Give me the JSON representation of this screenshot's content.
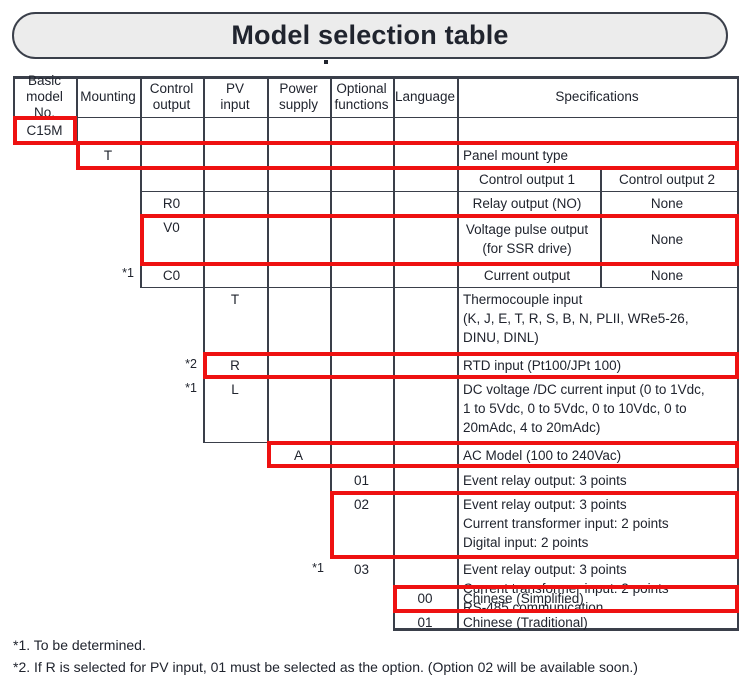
{
  "title": "Model selection table",
  "table": {
    "headers": [
      "Basic\nmodel No.",
      "Mounting",
      "Control\noutput",
      "PV\ninput",
      "Power\nsupply",
      "Optional\nfunctions",
      "Language",
      "Specifications"
    ],
    "subheaders": {
      "control_output_1": "Control output 1",
      "control_output_2": "Control output 2"
    },
    "rows": {
      "basic_model": {
        "code": "C15M"
      },
      "mounting": {
        "code": "T",
        "spec": "Panel mount type"
      },
      "control_output": [
        {
          "note": "",
          "code": "R0",
          "out1": "Relay output (NO)",
          "out2": "None"
        },
        {
          "note": "",
          "code": "V0",
          "out1": "Voltage pulse output\n(for SSR drive)",
          "out2": "None"
        },
        {
          "note": "*1",
          "code": "C0",
          "out1": "Current output",
          "out2": "None"
        }
      ],
      "pv_input": [
        {
          "note": "",
          "code": "T",
          "spec": "Thermocouple input\n(K, J, E, T, R, S, B, N, PLII, WRe5-26,\nDINU, DINL)"
        },
        {
          "note": "*2",
          "code": "R",
          "spec": "RTD input (Pt100/JPt 100)"
        },
        {
          "note": "*1",
          "code": "L",
          "spec": "DC voltage /DC current input (0 to 1Vdc,\n1 to 5Vdc, 0 to 5Vdc, 0 to 10Vdc, 0 to\n20mAdc, 4 to 20mAdc)"
        }
      ],
      "power_supply": [
        {
          "note": "",
          "code": "A",
          "spec": "AC Model (100 to 240Vac)"
        }
      ],
      "optional_functions": [
        {
          "note": "",
          "code": "01",
          "spec": "Event relay output: 3 points"
        },
        {
          "note": "",
          "code": "02",
          "spec": "Event relay output: 3 points\nCurrent transformer input: 2 points\nDigital input: 2 points"
        },
        {
          "note": "*1",
          "code": "03",
          "spec": "Event relay output: 3 points\nCurrent transformer input: 2 points\nRS-485 communication"
        }
      ],
      "language": [
        {
          "note": "",
          "code": "00",
          "spec": "Chinese (Simplified)"
        },
        {
          "note": "",
          "code": "01",
          "spec": "Chinese (Traditional)"
        }
      ]
    }
  },
  "footnotes": [
    "*1. To be determined.",
    "*2. If R is selected for PV input, 01 must be selected as the option. (Option 02 will be available soon.)"
  ],
  "colors": {
    "highlight": "#ee1111",
    "rule": "#3a3f4a",
    "banner_fill": "#ececec",
    "text": "#20242e"
  }
}
